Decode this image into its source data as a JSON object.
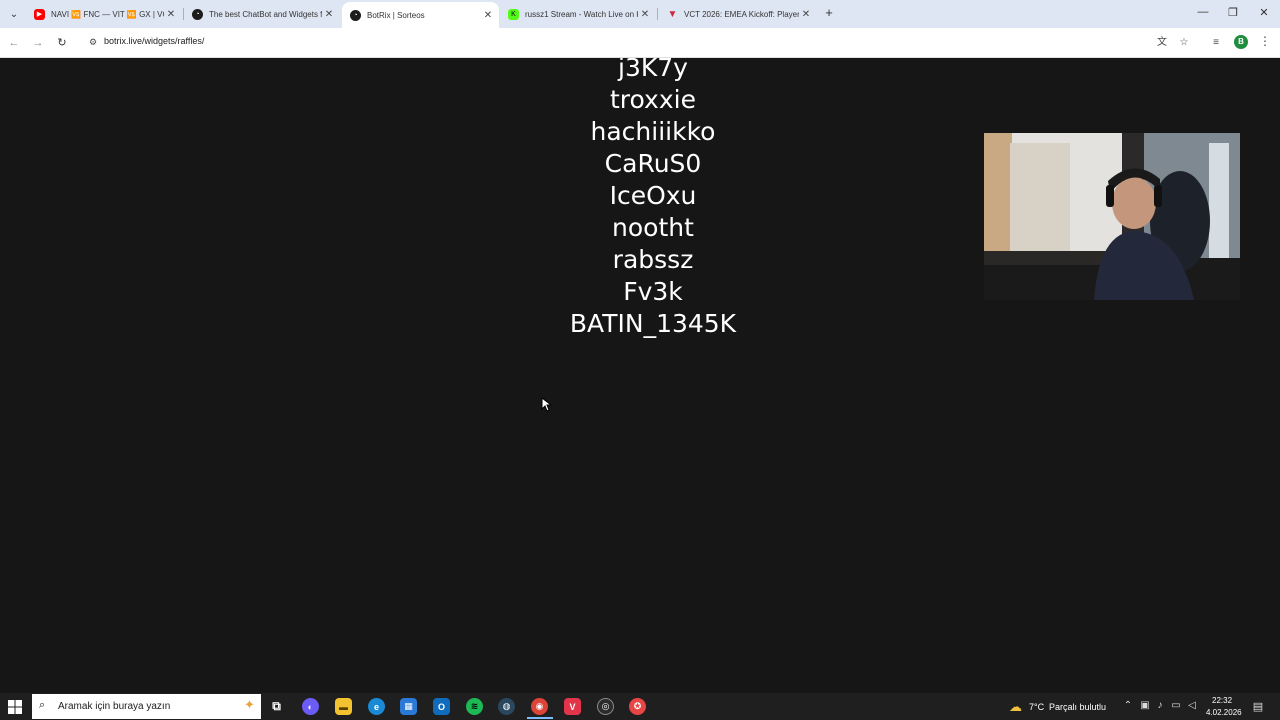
{
  "browser": {
    "tabs": [
      {
        "title": "NAVI 🆚 FNC — VIT 🆚 GX | VC",
        "favicon": "youtube-icon",
        "color": "#ff0000",
        "active": false
      },
      {
        "title": "The best ChatBot and Widgets f",
        "favicon": "botrix-icon",
        "color": "#1c1c1c",
        "active": false
      },
      {
        "title": "BotRix | Sorteos",
        "favicon": "botrix-icon",
        "color": "#1c1c1c",
        "active": true
      },
      {
        "title": "russz1 Stream - Watch Live on K",
        "favicon": "kick-icon",
        "color": "#53fc18",
        "active": false
      },
      {
        "title": "VCT 2026: EMEA Kickoff: Player",
        "favicon": "vlr-icon",
        "color": "#cf2b3f",
        "active": false
      }
    ],
    "address_url": "botrix.live/widgets/raffles/",
    "profile_initial": "B"
  },
  "raffle": {
    "cut_name": "...",
    "names": [
      "j3K7y",
      "troxxie",
      "hachiiikko",
      "CaRuS0",
      "IceOxu",
      "nootht",
      "rabssz",
      "Fv3k",
      "BATIN_1345K"
    ]
  },
  "taskbar": {
    "search_placeholder": "Aramak için buraya yazın",
    "apps": [
      {
        "name": "task-view",
        "color": "#1f1f1f",
        "glyph": "⧉"
      },
      {
        "name": "copilot",
        "color": "#6b5cf6",
        "glyph": "◐"
      },
      {
        "name": "file-explorer",
        "color": "#f2c230",
        "glyph": "▬"
      },
      {
        "name": "edge",
        "color": "#1a8ad4",
        "glyph": "e"
      },
      {
        "name": "microsoft-store",
        "color": "#2b79d6",
        "glyph": "▦"
      },
      {
        "name": "outlook",
        "color": "#0f6cbd",
        "glyph": "O"
      },
      {
        "name": "spotify",
        "color": "#1db954",
        "glyph": "≋"
      },
      {
        "name": "steam",
        "color": "#2a475e",
        "glyph": "◍"
      },
      {
        "name": "chrome",
        "color": "#db4437",
        "glyph": "◉"
      },
      {
        "name": "valorant",
        "color": "#e2354a",
        "glyph": "V"
      },
      {
        "name": "obs",
        "color": "#2b2b2b",
        "glyph": "◎"
      },
      {
        "name": "riot-client",
        "color": "#e84545",
        "glyph": "✪"
      }
    ],
    "weather_temp": "7°C",
    "weather_text": "Parçalı bulutlu",
    "time": "22:32",
    "date": "4.02.2026"
  }
}
